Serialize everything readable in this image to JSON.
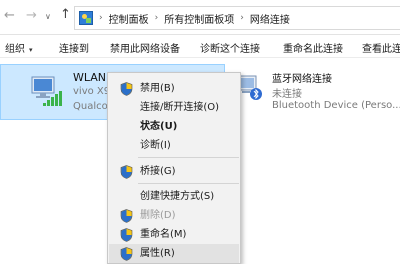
{
  "breadcrumb": {
    "items": [
      "控制面板",
      "所有控制面板项",
      "网络连接"
    ],
    "separator": "›"
  },
  "nav": {
    "back": "←",
    "forward": "→",
    "recent": "∨",
    "up": "↑"
  },
  "toolbar": {
    "organize": "组织",
    "organize_caret": "▾",
    "connect_to": "连接到",
    "disable": "禁用此网络设备",
    "diagnose": "诊断这个连接",
    "rename": "重命名此连接",
    "view_status": "查看此连"
  },
  "adapters": [
    {
      "name": "WLAN",
      "line1": "vivo X9s",
      "line2": "Qualcom"
    },
    {
      "name": "蓝牙网络连接",
      "line1": "未连接",
      "line2": "Bluetooth Device (Perso..."
    }
  ],
  "context_menu": {
    "items": [
      {
        "label": "禁用(B)",
        "icon": "shield-icon"
      },
      {
        "label": "连接/断开连接(O)",
        "icon": ""
      },
      {
        "label": "状态(U)",
        "icon": ""
      },
      {
        "label": "诊断(I)",
        "icon": ""
      },
      {
        "label": "桥接(G)",
        "icon": "shield-icon"
      },
      {
        "label": "创建快捷方式(S)",
        "icon": ""
      },
      {
        "label": "删除(D)",
        "icon": "shield-icon"
      },
      {
        "label": "重命名(M)",
        "icon": "shield-icon"
      },
      {
        "label": "属性(R)",
        "icon": "shield-icon"
      }
    ]
  },
  "colors": {
    "selection_bg": "#cce8ff",
    "selection_border": "#99d1ff",
    "menu_bg": "#f2f2f2",
    "menu_hover": "#e2e2e2",
    "shield_blue": "#2b6fc9",
    "shield_yellow": "#f5c518"
  }
}
